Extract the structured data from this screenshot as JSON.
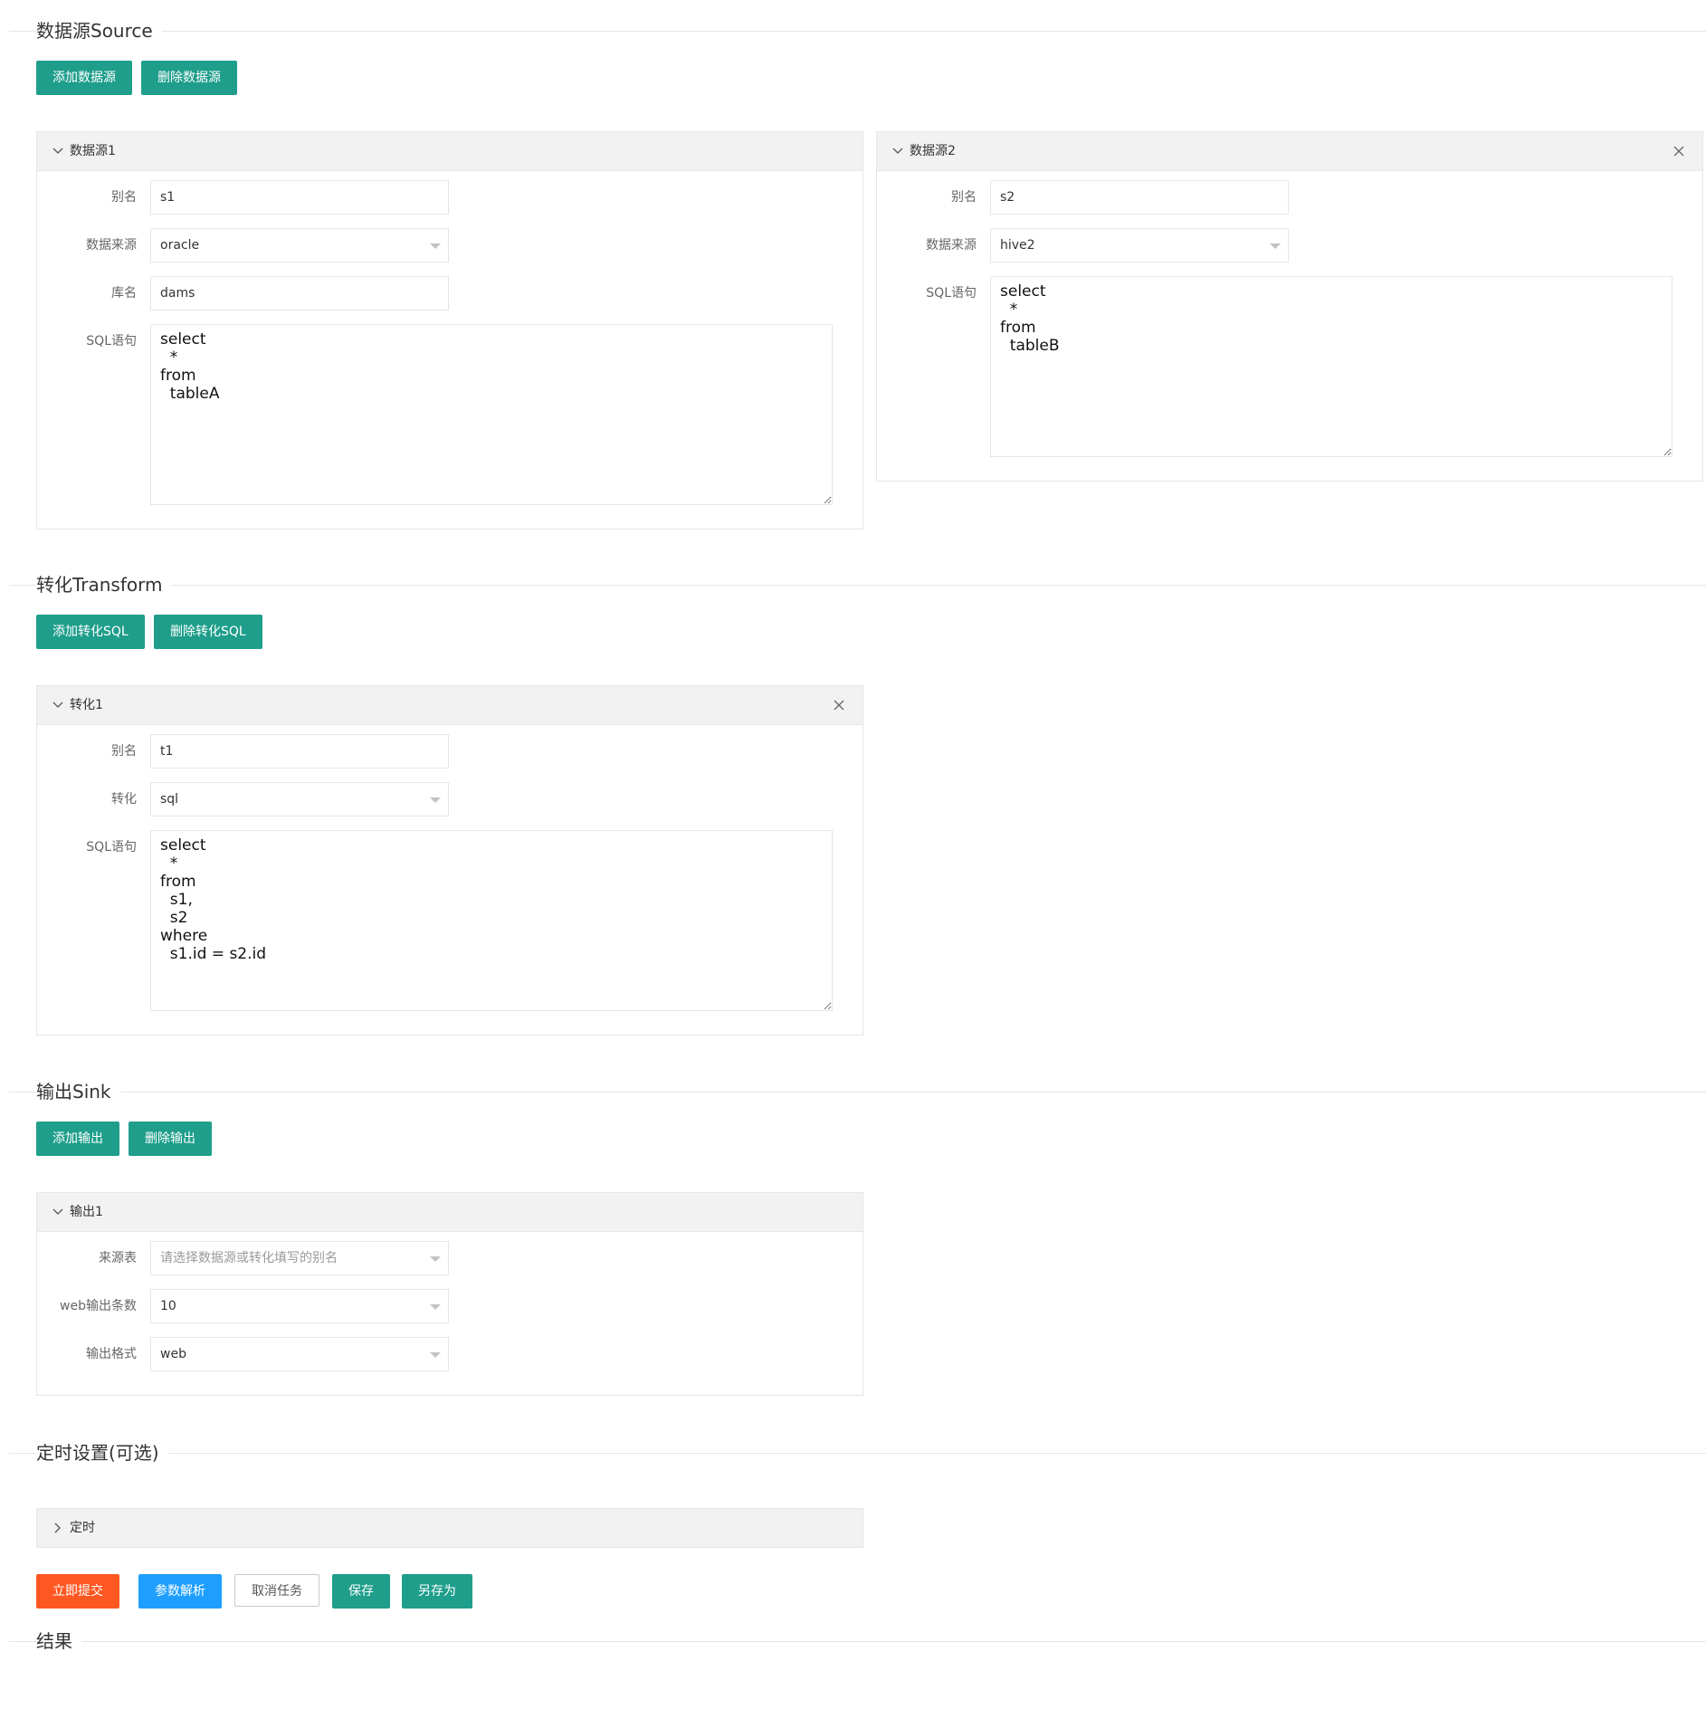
{
  "source": {
    "title": "数据源Source",
    "add_button": "添加数据源",
    "delete_button": "删除数据源",
    "panels": [
      {
        "title": "数据源1",
        "alias_label": "别名",
        "alias_value": "s1",
        "datasource_label": "数据来源",
        "datasource_value": "oracle",
        "db_label": "库名",
        "db_value": "dams",
        "sql_label": "SQL语句",
        "sql_value": "select\n  *\nfrom\n  tableA"
      },
      {
        "title": "数据源2",
        "alias_label": "别名",
        "alias_value": "s2",
        "datasource_label": "数据来源",
        "datasource_value": "hive2",
        "sql_label": "SQL语句",
        "sql_value": "select\n  *\nfrom\n  tableB"
      }
    ]
  },
  "transform": {
    "title": "转化Transform",
    "add_button": "添加转化SQL",
    "delete_button": "删除转化SQL",
    "panel": {
      "title": "转化1",
      "alias_label": "别名",
      "alias_value": "t1",
      "type_label": "转化",
      "type_value": "sql",
      "sql_label": "SQL语句",
      "sql_value": "select\n  *\nfrom\n  s1,\n  s2\nwhere\n  s1.id = s2.id"
    }
  },
  "sink": {
    "title": "输出Sink",
    "add_button": "添加输出",
    "delete_button": "删除输出",
    "panel": {
      "title": "输出1",
      "source_label": "来源表",
      "source_placeholder": "请选择数据源或转化填写的别名",
      "count_label": "web输出条数",
      "count_value": "10",
      "format_label": "输出格式",
      "format_value": "web"
    }
  },
  "schedule": {
    "title": "定时设置(可选)",
    "panel_title": "定时"
  },
  "actions": {
    "submit": "立即提交",
    "parse": "参数解析",
    "cancel": "取消任务",
    "save": "保存",
    "save_as": "另存为"
  },
  "result": {
    "title": "结果"
  },
  "colors": {
    "primary": "#1e9e8b",
    "danger": "#ff5722",
    "info": "#1e9fff"
  }
}
